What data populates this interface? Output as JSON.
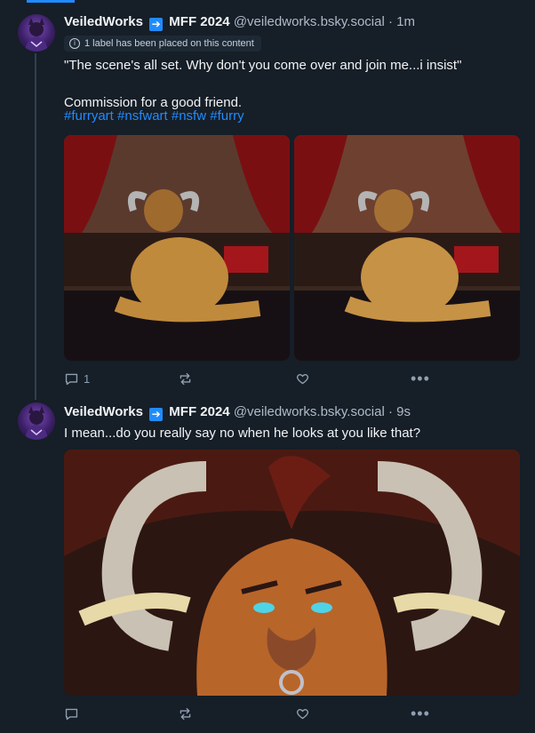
{
  "posts": [
    {
      "author": "VeiledWorks",
      "badge": "MFF 2024",
      "handle": "@veiledworks.bsky.social",
      "time": "· 1m",
      "label_notice": "1 label has been placed on this content",
      "text": "\"The scene's all set. Why don't you come over and join me...i insist\"\n\nCommission for a good friend.",
      "hashtags": "#furryart #nsfwart #nsfw #furry",
      "reply_count": "1",
      "repost_count": "",
      "like_count": ""
    },
    {
      "author": "VeiledWorks",
      "badge": "MFF 2024",
      "handle": "@veiledworks.bsky.social",
      "time": "· 9s",
      "text": "I mean...do you really say no when he looks at you like that?",
      "reply_count": "",
      "repost_count": "",
      "like_count": ""
    }
  ],
  "icons": {
    "reply": "speech-bubble-icon",
    "repost": "repost-arrows-icon",
    "like": "heart-icon",
    "more": "ellipsis-icon",
    "badge": "arrow-right-icon",
    "info": "info-circle-icon"
  },
  "colors": {
    "background": "#161e27",
    "accent": "#208bfe",
    "muted_text": "#aebbc9"
  }
}
